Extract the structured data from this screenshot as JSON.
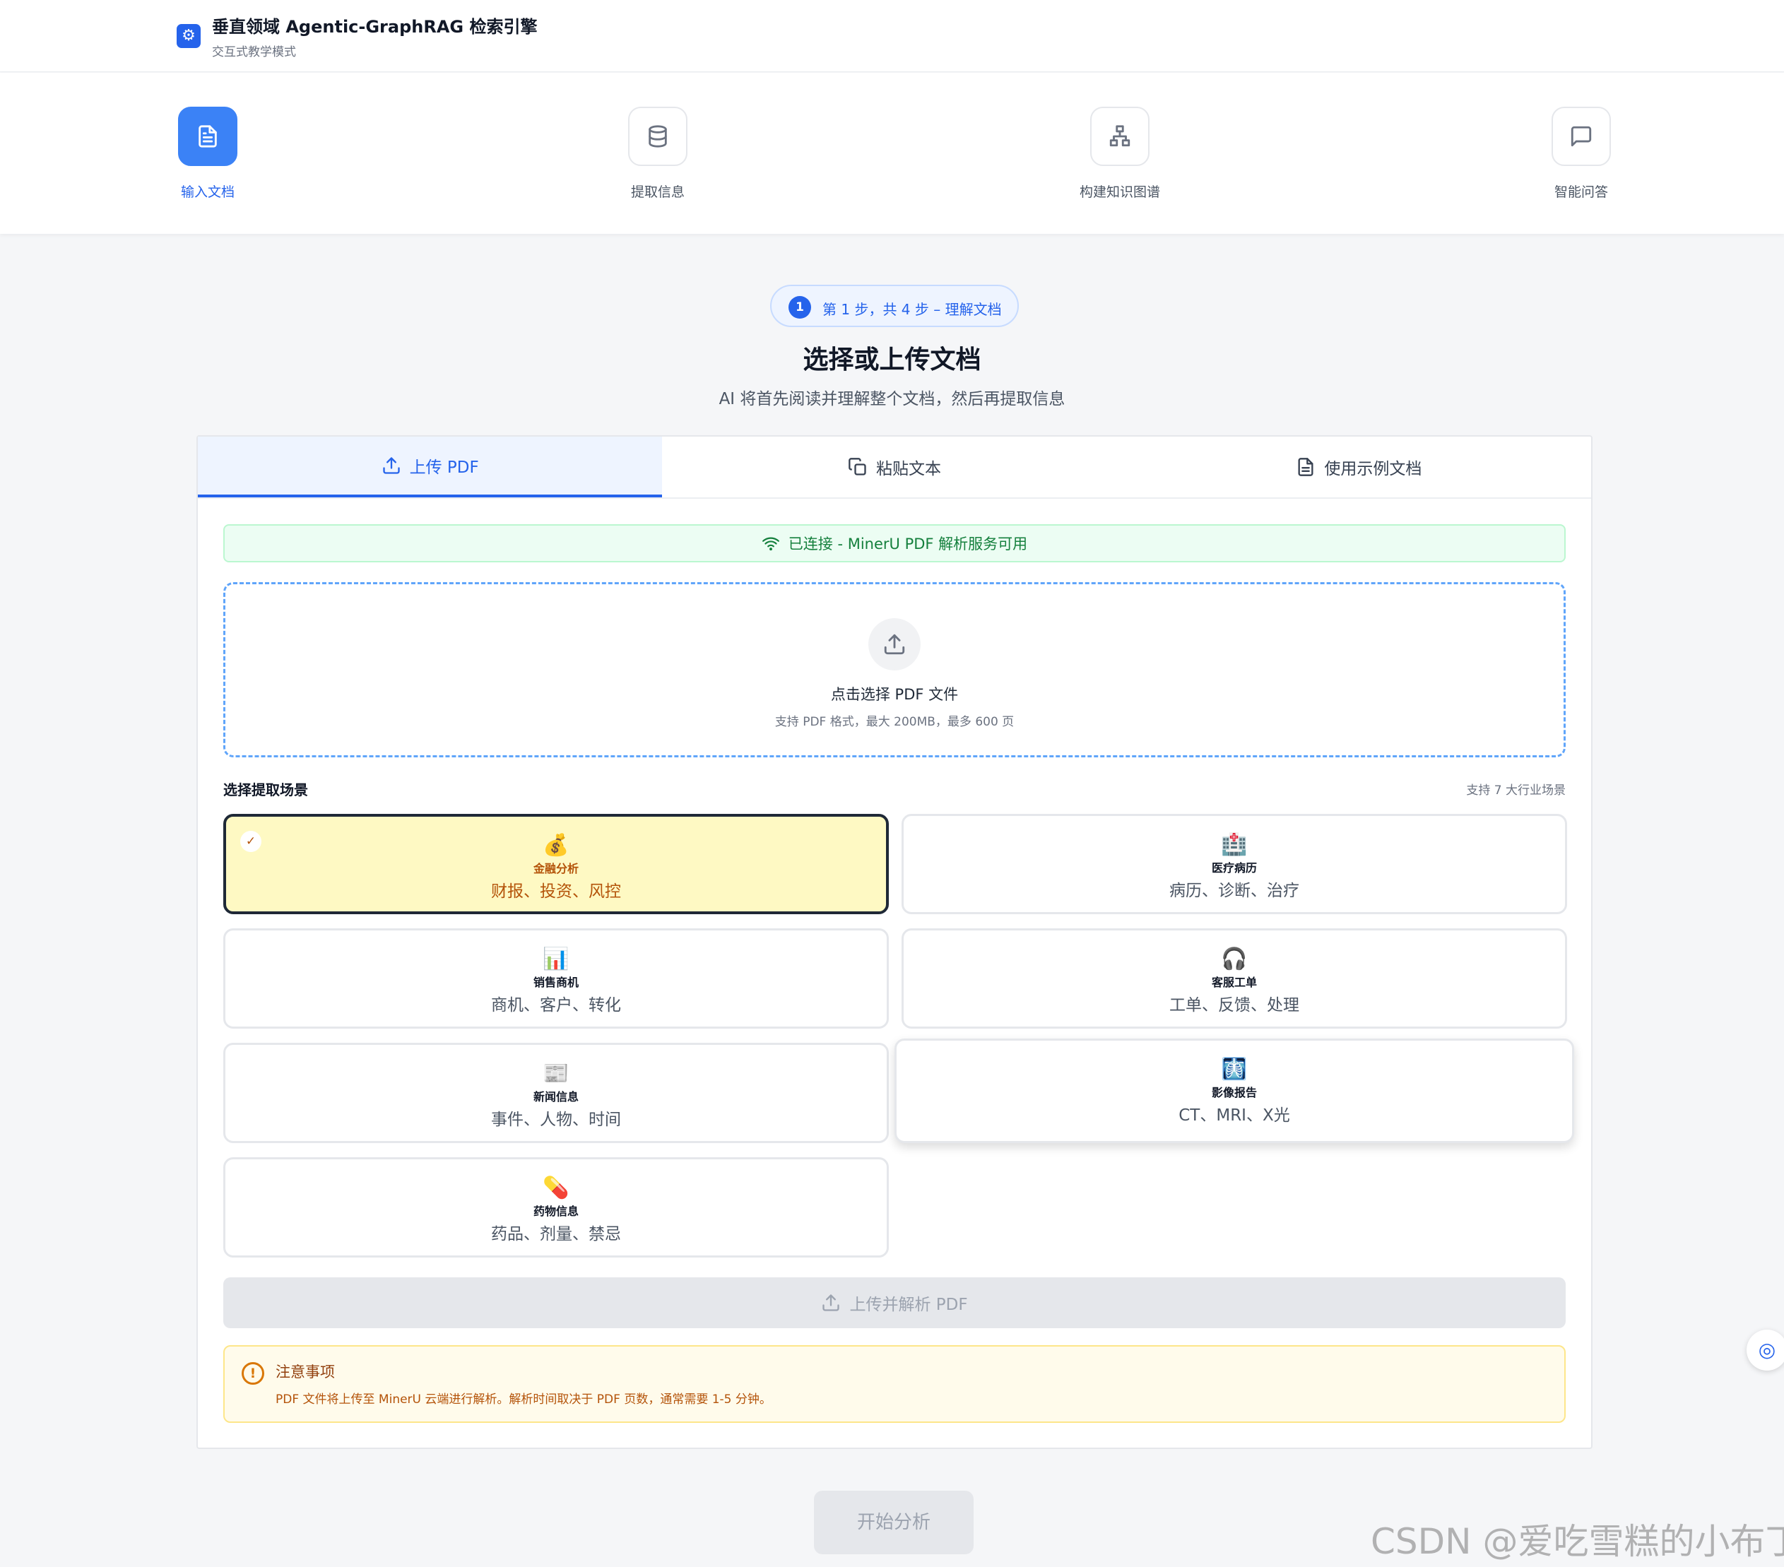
{
  "app": {
    "title": "垂直领域 Agentic-GraphRAG 检索引擎",
    "subtitle": "交互式教学模式"
  },
  "steps": [
    {
      "label": "输入文档",
      "icon": "document-icon",
      "active": true
    },
    {
      "label": "提取信息",
      "icon": "database-icon",
      "active": false
    },
    {
      "label": "构建知识图谱",
      "icon": "graph-icon",
      "active": false
    },
    {
      "label": "智能问答",
      "icon": "chat-icon",
      "active": false
    }
  ],
  "badge": {
    "number": "1",
    "text": "第 1 步，共 4 步 – 理解文档"
  },
  "main": {
    "title": "选择或上传文档",
    "subtitle": "AI 将首先阅读并理解整个文档，然后再提取信息"
  },
  "tabs": [
    {
      "label": "上传 PDF",
      "icon": "upload-icon",
      "active": true
    },
    {
      "label": "粘贴文本",
      "icon": "copy-icon",
      "active": false
    },
    {
      "label": "使用示例文档",
      "icon": "file-icon",
      "active": false
    }
  ],
  "connection": {
    "text": "已连接 - MinerU PDF 解析服务可用",
    "color": "#15803d"
  },
  "dropzone": {
    "title": "点击选择 PDF 文件",
    "hint": "支持 PDF 格式，最大 200MB，最多 600 页"
  },
  "scenarios": {
    "label": "选择提取场景",
    "count": "支持 7 大行业场景",
    "items": [
      {
        "emoji": "💰",
        "name": "金融分析",
        "desc": "财报、投资、风控",
        "selected": true
      },
      {
        "emoji": "🏥",
        "name": "医疗病历",
        "desc": "病历、诊断、治疗",
        "selected": false
      },
      {
        "emoji": "📊",
        "name": "销售商机",
        "desc": "商机、客户、转化",
        "selected": false
      },
      {
        "emoji": "🎧",
        "name": "客服工单",
        "desc": "工单、反馈、处理",
        "selected": false
      },
      {
        "emoji": "📰",
        "name": "新闻信息",
        "desc": "事件、人物、时间",
        "selected": false
      },
      {
        "emoji": "🩻",
        "name": "影像报告",
        "desc": "CT、MRI、X光",
        "selected": false
      },
      {
        "emoji": "💊",
        "name": "药物信息",
        "desc": "药品、剂量、禁忌",
        "selected": false
      }
    ]
  },
  "upload_button": "上传并解析 PDF",
  "notice": {
    "title": "注意事项",
    "text": "PDF 文件将上传至 MinerU 云端进行解析。解析时间取决于 PDF 页数，通常需要 1-5 分钟。"
  },
  "start_button": "开始分析",
  "watermark": "CSDN @爱吃雪糕的小布丁",
  "colors": {
    "accent": "#2563eb",
    "selected_bg": "#fef9c3",
    "success": "#15803d",
    "warning": "#d97706"
  }
}
